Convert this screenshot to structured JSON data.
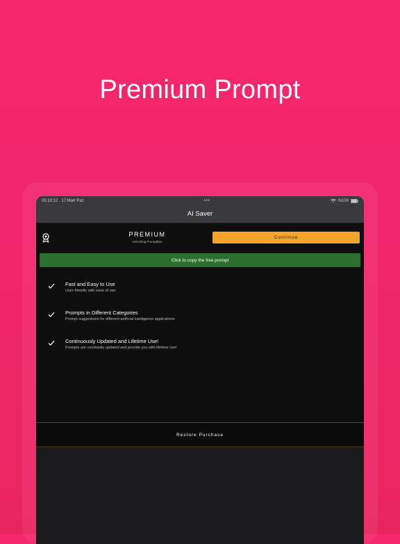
{
  "hero": {
    "title": "Premium Prompt"
  },
  "status_bar": {
    "time": "05:10:12",
    "date": "17 Mart Paz",
    "dots": "•••",
    "battery": "%100"
  },
  "navbar": {
    "title": "AI Saver"
  },
  "premium": {
    "title": "PREMIUM",
    "subtitle": "Unlocking PromptBox",
    "continue_label": "Continue"
  },
  "copy_button": {
    "label": "Click to copy the free prompt"
  },
  "features": [
    {
      "title": "Fast and Easy to Use",
      "desc": "User-friendly with ease of use"
    },
    {
      "title": "Prompts in Different Categories",
      "desc": "Prompt suggestions for different artificial intelligence applications"
    },
    {
      "title": "Continuously Updated and Lifetime Use!",
      "desc": "Prompts are constantly updated and provide you with lifetime use!"
    }
  ],
  "restore": {
    "label": "Restore Purchase"
  },
  "colors": {
    "background": "#f5276d",
    "accent": "#f4a42b",
    "copy_green": "#2c6e2d",
    "border_brown": "#5a4323"
  },
  "icons": {
    "premium": "award-icon",
    "check": "check-icon",
    "wifi": "wifi-icon",
    "battery": "battery-icon"
  }
}
